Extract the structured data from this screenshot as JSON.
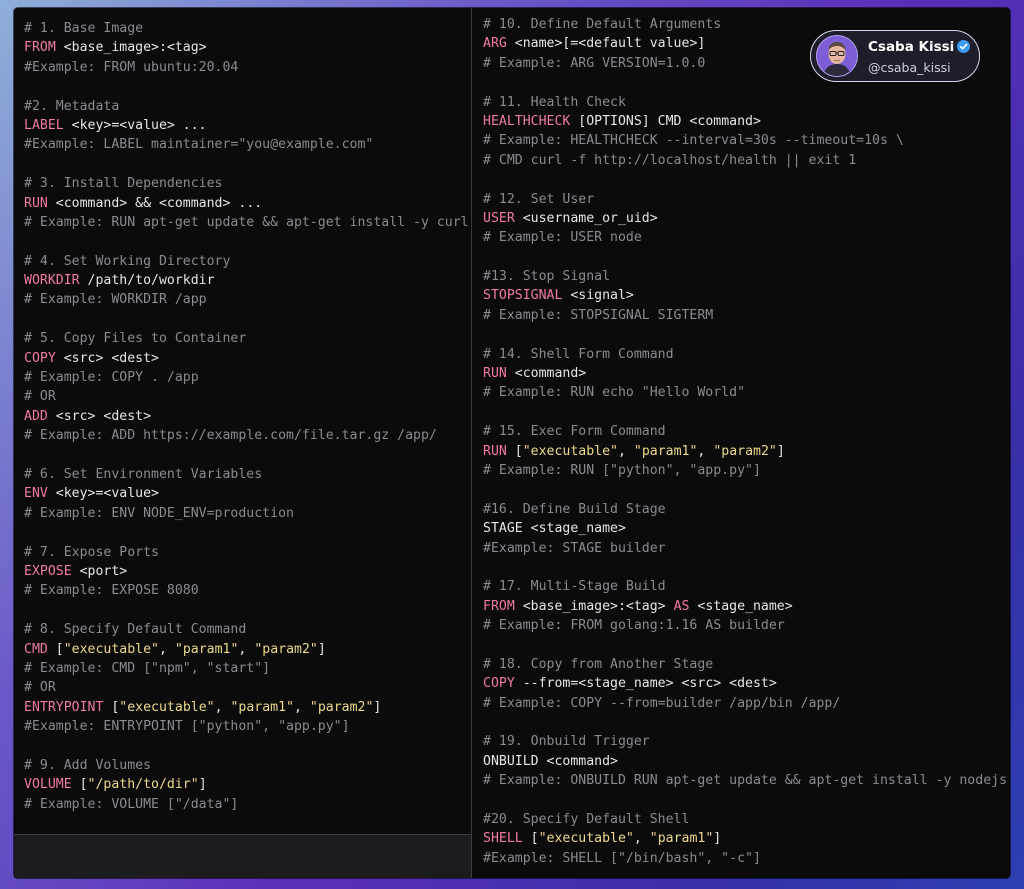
{
  "profile": {
    "name": "Csaba Kissi",
    "handle": "@csaba_kissi",
    "verified_color": "#3d9bf0",
    "avatar_icon": "person-avatar-icon"
  },
  "colors": {
    "background_code": "#0b0b0c",
    "keyword": "#f07ba0",
    "string": "#ecd98a",
    "comment": "#8a8a92",
    "text": "#e6e6e6"
  },
  "left_pane": [
    [
      [
        "c",
        "# 1. Base Image"
      ]
    ],
    [
      [
        "k",
        "FROM"
      ],
      [
        "t",
        " <base_image>:<tag>"
      ]
    ],
    [
      [
        "c",
        "#Example: FROM ubuntu:20.04"
      ]
    ],
    [
      [
        "t",
        " "
      ]
    ],
    [
      [
        "c",
        "#2. Metadata"
      ]
    ],
    [
      [
        "k",
        "LABEL"
      ],
      [
        "t",
        " <key>=<value> ..."
      ]
    ],
    [
      [
        "c",
        "#Example: LABEL maintainer=\"you@example.com\""
      ]
    ],
    [
      [
        "t",
        " "
      ]
    ],
    [
      [
        "c",
        "# 3. Install Dependencies"
      ]
    ],
    [
      [
        "k",
        "RUN"
      ],
      [
        "t",
        " <command> && <command> ..."
      ]
    ],
    [
      [
        "c",
        "# Example: RUN apt-get update && apt-get install -y curl"
      ]
    ],
    [
      [
        "t",
        " "
      ]
    ],
    [
      [
        "c",
        "# 4. Set Working Directory"
      ]
    ],
    [
      [
        "k",
        "WORKDIR"
      ],
      [
        "t",
        " /path/to/workdir"
      ]
    ],
    [
      [
        "c",
        "# Example: WORKDIR /app"
      ]
    ],
    [
      [
        "t",
        " "
      ]
    ],
    [
      [
        "c",
        "# 5. Copy Files to Container"
      ]
    ],
    [
      [
        "k",
        "COPY"
      ],
      [
        "t",
        " <src> <dest>"
      ]
    ],
    [
      [
        "c",
        "# Example: COPY . /app"
      ]
    ],
    [
      [
        "c",
        "# OR"
      ]
    ],
    [
      [
        "k",
        "ADD"
      ],
      [
        "t",
        " <src> <dest>"
      ]
    ],
    [
      [
        "c",
        "# Example: ADD https://example.com/file.tar.gz /app/"
      ]
    ],
    [
      [
        "t",
        " "
      ]
    ],
    [
      [
        "c",
        "# 6. Set Environment Variables"
      ]
    ],
    [
      [
        "k",
        "ENV"
      ],
      [
        "t",
        " <key>=<value>"
      ]
    ],
    [
      [
        "c",
        "# Example: ENV NODE_ENV=production"
      ]
    ],
    [
      [
        "t",
        " "
      ]
    ],
    [
      [
        "c",
        "# 7. Expose Ports"
      ]
    ],
    [
      [
        "k",
        "EXPOSE"
      ],
      [
        "t",
        " <port>"
      ]
    ],
    [
      [
        "c",
        "# Example: EXPOSE 8080"
      ]
    ],
    [
      [
        "t",
        " "
      ]
    ],
    [
      [
        "c",
        "# 8. Specify Default Command"
      ]
    ],
    [
      [
        "k",
        "CMD"
      ],
      [
        "t",
        " ["
      ],
      [
        "s",
        "\"executable\""
      ],
      [
        "t",
        ", "
      ],
      [
        "s",
        "\"param1\""
      ],
      [
        "t",
        ", "
      ],
      [
        "s",
        "\"param2\""
      ],
      [
        "t",
        "]"
      ]
    ],
    [
      [
        "c",
        "# Example: CMD [\"npm\", \"start\"]"
      ]
    ],
    [
      [
        "c",
        "# OR"
      ]
    ],
    [
      [
        "k",
        "ENTRYPOINT"
      ],
      [
        "t",
        " ["
      ],
      [
        "s",
        "\"executable\""
      ],
      [
        "t",
        ", "
      ],
      [
        "s",
        "\"param1\""
      ],
      [
        "t",
        ", "
      ],
      [
        "s",
        "\"param2\""
      ],
      [
        "t",
        "]"
      ]
    ],
    [
      [
        "c",
        "#Example: ENTRYPOINT [\"python\", \"app.py\"]"
      ]
    ],
    [
      [
        "t",
        " "
      ]
    ],
    [
      [
        "c",
        "# 9. Add Volumes"
      ]
    ],
    [
      [
        "k",
        "VOLUME"
      ],
      [
        "t",
        " ["
      ],
      [
        "s",
        "\"/path/to/dir\""
      ],
      [
        "t",
        "]"
      ]
    ],
    [
      [
        "c",
        "# Example: VOLUME [\"/data\"]"
      ]
    ]
  ],
  "right_pane": [
    [
      [
        "c",
        "# 10. Define Default Arguments"
      ]
    ],
    [
      [
        "k",
        "ARG"
      ],
      [
        "t",
        " <name>[=<default value>]"
      ]
    ],
    [
      [
        "c",
        "# Example: ARG VERSION=1.0.0"
      ]
    ],
    [
      [
        "t",
        " "
      ]
    ],
    [
      [
        "c",
        "# 11. Health Check"
      ]
    ],
    [
      [
        "k",
        "HEALTHCHECK"
      ],
      [
        "t",
        " [OPTIONS] CMD <command>"
      ]
    ],
    [
      [
        "c",
        "# Example: HEALTHCHECK --interval=30s --timeout=10s \\"
      ]
    ],
    [
      [
        "c",
        "# CMD curl -f http://localhost/health || exit 1"
      ]
    ],
    [
      [
        "t",
        " "
      ]
    ],
    [
      [
        "c",
        "# 12. Set User"
      ]
    ],
    [
      [
        "k",
        "USER"
      ],
      [
        "t",
        " <username_or_uid>"
      ]
    ],
    [
      [
        "c",
        "# Example: USER node"
      ]
    ],
    [
      [
        "t",
        " "
      ]
    ],
    [
      [
        "c",
        "#13. Stop Signal"
      ]
    ],
    [
      [
        "k",
        "STOPSIGNAL"
      ],
      [
        "t",
        " <signal>"
      ]
    ],
    [
      [
        "c",
        "# Example: STOPSIGNAL SIGTERM"
      ]
    ],
    [
      [
        "t",
        " "
      ]
    ],
    [
      [
        "c",
        "# 14. Shell Form Command"
      ]
    ],
    [
      [
        "k",
        "RUN"
      ],
      [
        "t",
        " <command>"
      ]
    ],
    [
      [
        "c",
        "# Example: RUN echo \"Hello World\""
      ]
    ],
    [
      [
        "t",
        " "
      ]
    ],
    [
      [
        "c",
        "# 15. Exec Form Command"
      ]
    ],
    [
      [
        "k",
        "RUN"
      ],
      [
        "t",
        " ["
      ],
      [
        "s",
        "\"executable\""
      ],
      [
        "t",
        ", "
      ],
      [
        "s",
        "\"param1\""
      ],
      [
        "t",
        ", "
      ],
      [
        "s",
        "\"param2\""
      ],
      [
        "t",
        "]"
      ]
    ],
    [
      [
        "c",
        "# Example: RUN [\"python\", \"app.py\"]"
      ]
    ],
    [
      [
        "t",
        " "
      ]
    ],
    [
      [
        "c",
        "#16. Define Build Stage"
      ]
    ],
    [
      [
        "t",
        "STAGE <stage_name>"
      ]
    ],
    [
      [
        "c",
        "#Example: STAGE builder"
      ]
    ],
    [
      [
        "t",
        " "
      ]
    ],
    [
      [
        "c",
        "# 17. Multi-Stage Build"
      ]
    ],
    [
      [
        "k",
        "FROM"
      ],
      [
        "t",
        " <base_image>:<tag> "
      ],
      [
        "k",
        "AS"
      ],
      [
        "t",
        " <stage_name>"
      ]
    ],
    [
      [
        "c",
        "# Example: FROM golang:1.16 AS builder"
      ]
    ],
    [
      [
        "t",
        " "
      ]
    ],
    [
      [
        "c",
        "# 18. Copy from Another Stage"
      ]
    ],
    [
      [
        "k",
        "COPY"
      ],
      [
        "t",
        " --from=<stage_name> <src> <dest>"
      ]
    ],
    [
      [
        "c",
        "# Example: COPY --from=builder /app/bin /app/"
      ]
    ],
    [
      [
        "t",
        " "
      ]
    ],
    [
      [
        "c",
        "# 19. Onbuild Trigger"
      ]
    ],
    [
      [
        "t",
        "ONBUILD <command>"
      ]
    ],
    [
      [
        "c",
        "# Example: ONBUILD RUN apt-get update && apt-get install -y nodejs"
      ]
    ],
    [
      [
        "t",
        " "
      ]
    ],
    [
      [
        "c",
        "#20. Specify Default Shell"
      ]
    ],
    [
      [
        "k",
        "SHELL"
      ],
      [
        "t",
        " ["
      ],
      [
        "s",
        "\"executable\""
      ],
      [
        "t",
        ", "
      ],
      [
        "s",
        "\"param1\""
      ],
      [
        "t",
        "]"
      ]
    ],
    [
      [
        "c",
        "#Example: SHELL [\"/bin/bash\", \"-c\"]"
      ]
    ]
  ]
}
